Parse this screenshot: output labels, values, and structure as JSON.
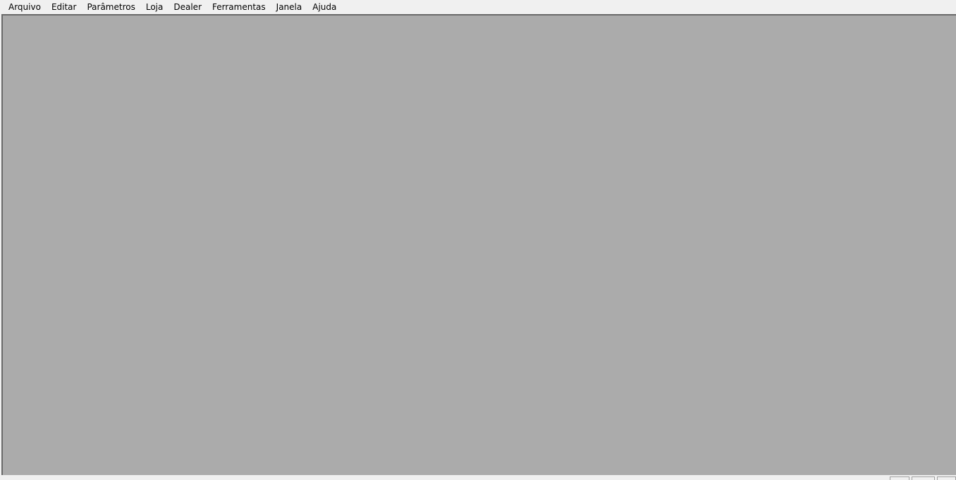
{
  "menubar": {
    "items": [
      {
        "label": "Arquivo"
      },
      {
        "label": "Editar"
      },
      {
        "label": "Parâmetros"
      },
      {
        "label": "Loja"
      },
      {
        "label": "Dealer"
      },
      {
        "label": "Ferramentas"
      },
      {
        "label": "Janela"
      },
      {
        "label": "Ajuda"
      }
    ]
  },
  "colors": {
    "menubar_background": "#f0f0f0",
    "workspace_background": "#ababab",
    "workspace_border": "#696969",
    "text": "#000000"
  }
}
